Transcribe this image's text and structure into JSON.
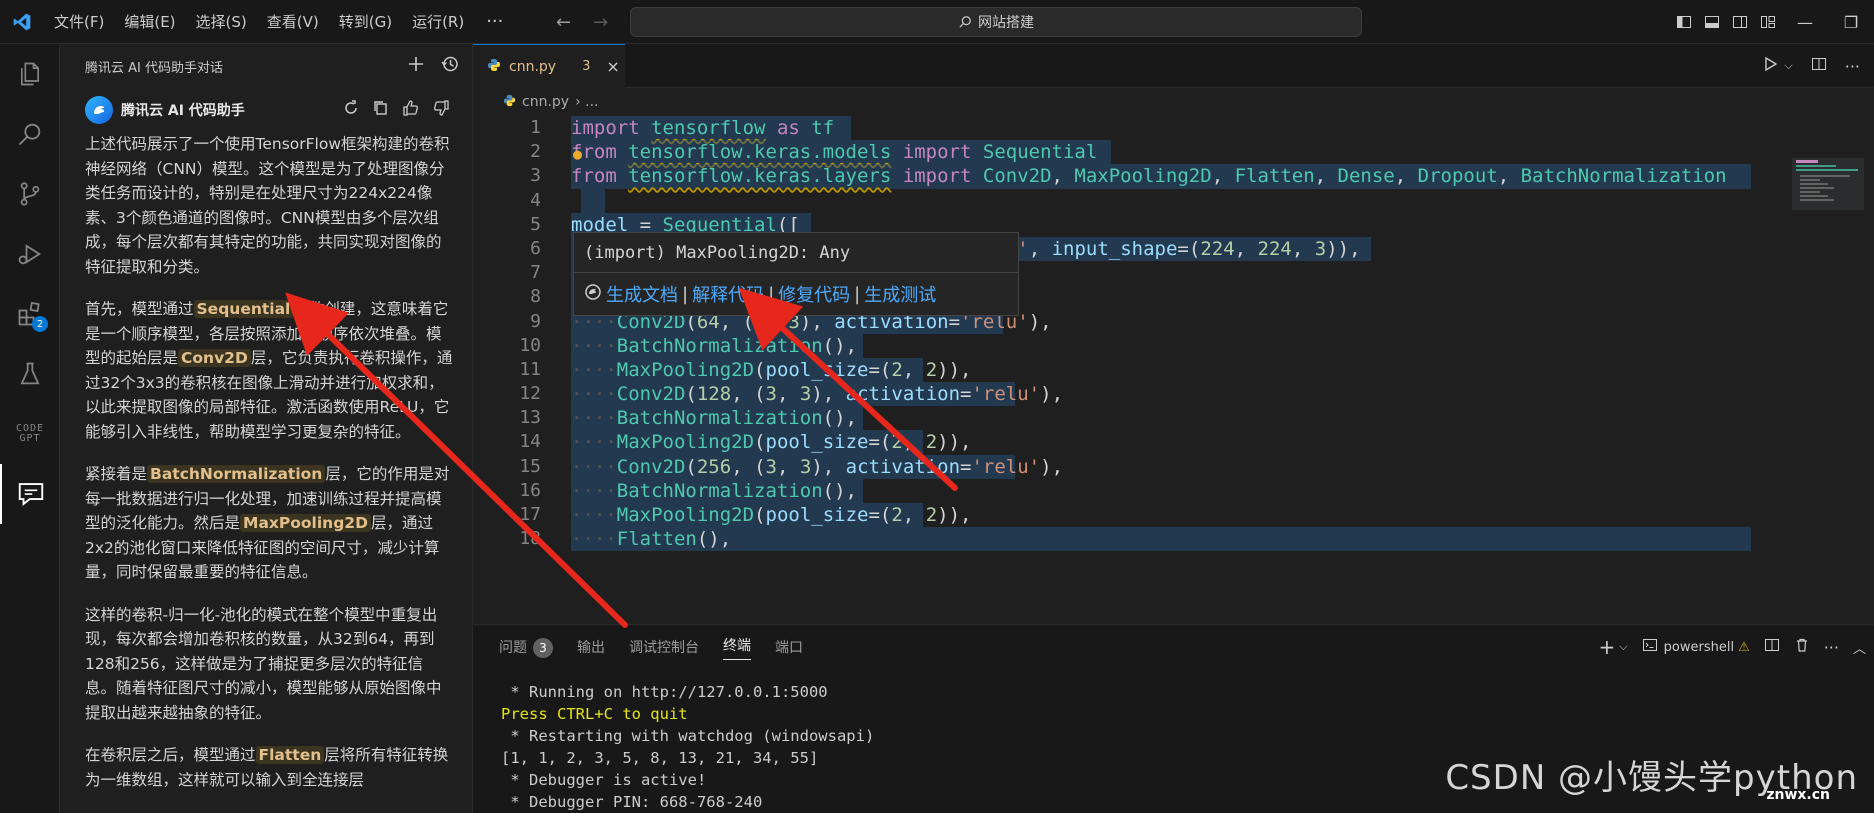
{
  "menu": [
    "文件(F)",
    "编辑(E)",
    "选择(S)",
    "查看(V)",
    "转到(G)",
    "运行(R)"
  ],
  "menu_more": "···",
  "command_center": "网站搭建",
  "side": {
    "title": "腾讯云 AI 代码助手对话",
    "assistant_name": "腾讯云 AI 代码助手",
    "paragraphs": [
      [
        "上述代码展示了一个使用TensorFlow框架构建的卷积神经网络（CNN）模型。这个模型是为了处理图像分类任务而设计的，特别是在处理尺寸为224x224像素、3个颜色通道的图像时。CNN模型由多个层次组成，每个层次都有其特定的功能，共同实现对图像的特征提取和分类。"
      ],
      [
        "首先，模型通过",
        {
          "hl": "Sequential"
        },
        "函数创建，这意味着它是一个顺序模型，各层按照添加的顺序依次堆叠。模型的起始层是",
        {
          "hl": "Conv2D"
        },
        "层，它负责执行卷积操作，通过32个3x3的卷积核在图像上滑动并进行加权求和，以此来提取图像的局部特征。激活函数使用ReLU，它能够引入非线性，帮助模型学习更复杂的特征。"
      ],
      [
        "紧接着是",
        {
          "hl": "BatchNormalization"
        },
        "层，它的作用是对每一批数据进行归一化处理，加速训练过程并提高模型的泛化能力。然后是",
        {
          "hl": "MaxPooling2D"
        },
        "层，通过2x2的池化窗口来降低特征图的空间尺寸，减少计算量，同时保留最重要的特征信息。"
      ],
      [
        "这样的卷积-归一化-池化的模式在整个模型中重复出现，每次都会增加卷积核的数量，从32到64，再到128和256，这样做是为了捕捉更多层次的特征信息。随着特征图尺寸的减小，模型能够从原始图像中提取出越来越抽象的特征。"
      ],
      [
        "在卷积层之后，模型通过",
        {
          "hl": "Flatten"
        },
        "层将所有特征转换为一维数组，这样就可以输入到全连接层"
      ]
    ]
  },
  "editor": {
    "tab_name": "cnn.py",
    "tab_problems": "3",
    "tab_close": "×",
    "breadcrumb_file": "cnn.py",
    "breadcrumb_sep": "› ...",
    "line_numbers": [
      "1",
      "2",
      "3",
      "4",
      "5",
      "6",
      "7",
      "8",
      "9",
      "10",
      "11",
      "12",
      "13",
      "14",
      "15",
      "16",
      "17",
      "18"
    ],
    "hover_signature": "(import) MaxPooling2D: Any",
    "hover_links": [
      "生成文档",
      "解释代码",
      "修复代码",
      "生成测试"
    ],
    "hover_sep": "|"
  },
  "panel": {
    "tabs": [
      "问题",
      "输出",
      "调试控制台",
      "终端",
      "端口"
    ],
    "problems_count": "3",
    "active_tab": "终端",
    "shell": "powershell",
    "terminal_lines": [
      " * Running on http://127.0.0.1:5000",
      "Press CTRL+C to quit",
      " * Restarting with watchdog (windowsapi)",
      "[1, 1, 2, 3, 5, 8, 13, 21, 34, 55]",
      " * Debugger is active!",
      " * Debugger PIN: 668-768-240"
    ]
  },
  "activity": {
    "extensions_badge": "2",
    "codegpt_label": [
      "CODE",
      "GPT"
    ]
  },
  "watermark": {
    "text": "CSDN @小馒头学python",
    "site": "znwx.cn"
  },
  "colors": {
    "accent": "#0078d4",
    "highlight_text": "#e2c08d",
    "link": "#4daafc",
    "arrow": "#e8271c"
  }
}
